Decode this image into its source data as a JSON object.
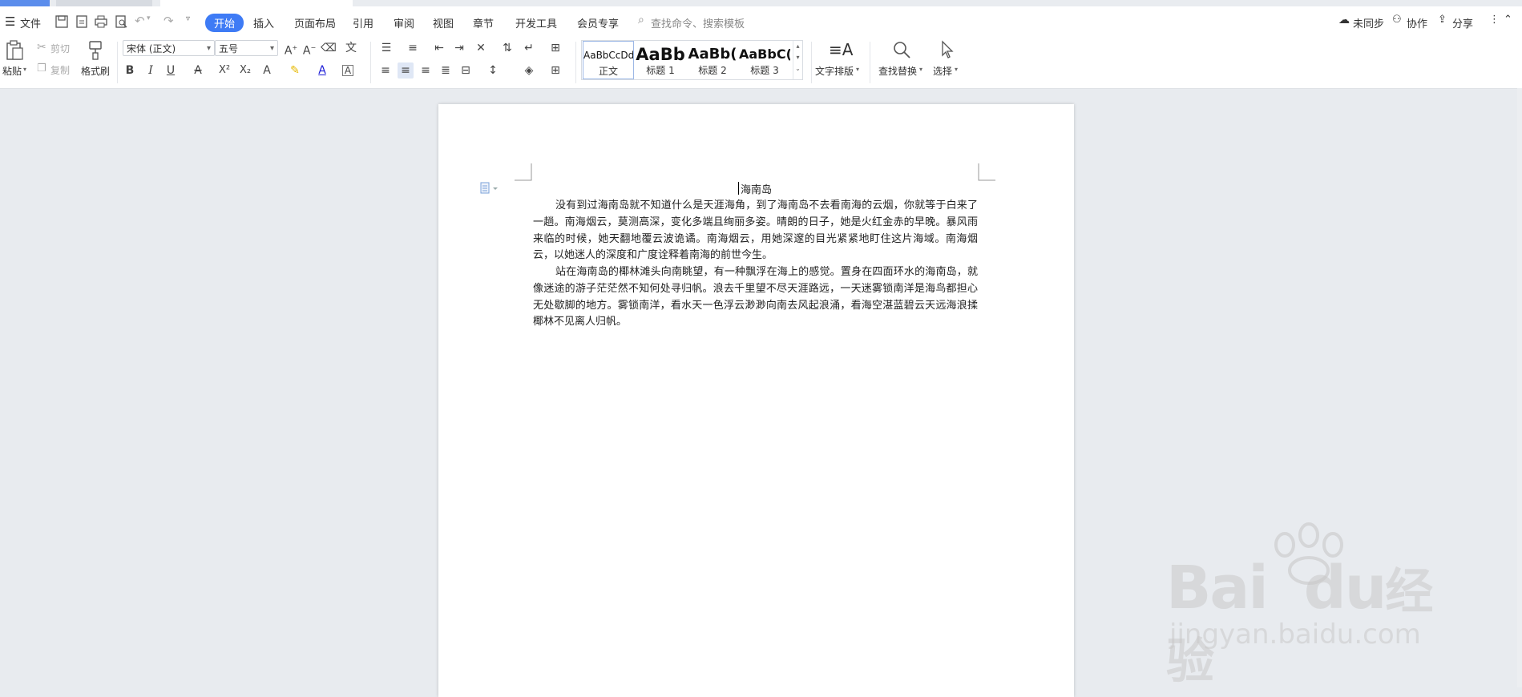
{
  "menubar": {
    "file": "文件",
    "tabs": [
      "开始",
      "插入",
      "页面布局",
      "引用",
      "审阅",
      "视图",
      "章节",
      "开发工具",
      "会员专享"
    ],
    "search_hint": "查找命令、搜索模板",
    "sync": "未同步",
    "collab": "协作",
    "share": "分享"
  },
  "ribbon": {
    "paste": "粘贴",
    "cut": "剪切",
    "copy": "复制",
    "format_painter": "格式刷",
    "font_name": "宋体 (正文)",
    "font_size": "五号",
    "styles": [
      {
        "preview": "AaBbCcDd",
        "name": "正文"
      },
      {
        "preview": "AaBb",
        "name": "标题 1"
      },
      {
        "preview": "AaBb(",
        "name": "标题 2"
      },
      {
        "preview": "AaBbC(",
        "name": "标题 3"
      }
    ],
    "text_layout": "文字排版",
    "find_replace": "查找替换",
    "select": "选择"
  },
  "document": {
    "title": "海南岛",
    "paragraphs": [
      "没有到过海南岛就不知道什么是天涯海角，到了海南岛不去看南海的云烟，你就等于白来了一趟。南海烟云，莫测高深，变化多端且绚丽多姿。晴朗的日子，她是火红金赤的早晚。暴风雨来临的时候，她天翻地覆云波诡谲。南海烟云，用她深邃的目光紧紧地盯住这片海域。南海烟云，以她迷人的深度和广度诠释着南海的前世今生。",
      "站在海南岛的椰林滩头向南眺望，有一种飘浮在海上的感觉。置身在四面环水的海南岛，就像迷途的游子茫茫然不知何处寻归帆。浪去千里望不尽天涯路远，一天迷雾锁南洋是海鸟都担心无处歇脚的地方。雾锁南洋，看水天一色浮云渺渺向南去风起浪涌，看海空湛蓝碧云天远海浪揉椰林不见离人归帆。"
    ]
  },
  "watermark": {
    "brand": "Bai",
    "brand2": "du",
    "cn": "经验",
    "url": "jingyan.baidu.com"
  },
  "colors": {
    "accent": "#3e7bf5",
    "page_bg": "#e8ebef"
  }
}
